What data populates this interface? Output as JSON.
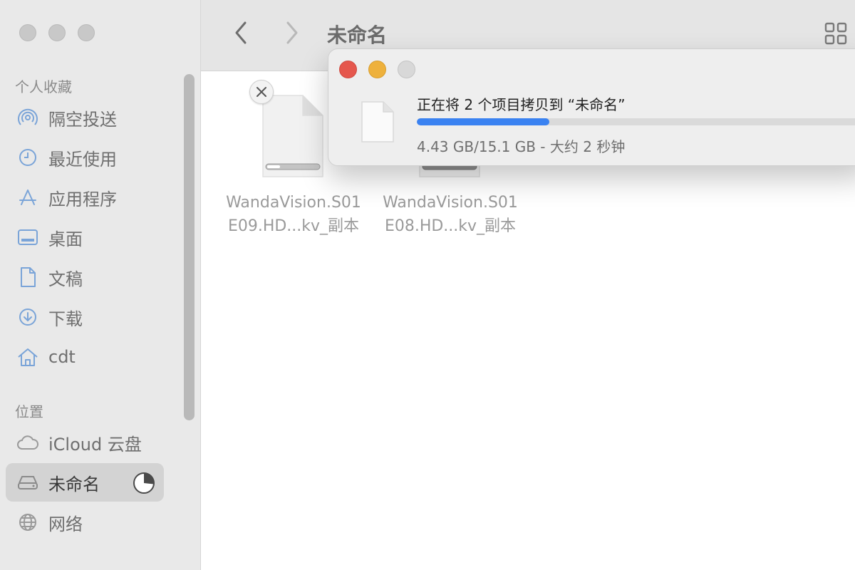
{
  "sidebar": {
    "favorites_title": "个人收藏",
    "locations_title": "位置",
    "favorites": [
      {
        "label": "隔空投送",
        "icon": "airdrop-icon"
      },
      {
        "label": "最近使用",
        "icon": "clock-icon"
      },
      {
        "label": "应用程序",
        "icon": "applications-icon"
      },
      {
        "label": "桌面",
        "icon": "desktop-icon"
      },
      {
        "label": "文稿",
        "icon": "document-icon"
      },
      {
        "label": "下载",
        "icon": "download-icon"
      },
      {
        "label": "cdt",
        "icon": "home-icon"
      }
    ],
    "locations": [
      {
        "label": "iCloud 云盘",
        "icon": "cloud-icon"
      },
      {
        "label": "未命名",
        "icon": "drive-icon",
        "selected": true
      },
      {
        "label": "网络",
        "icon": "globe-icon"
      }
    ]
  },
  "toolbar": {
    "title": "未命名"
  },
  "files": [
    {
      "name_line1": "WandaVision.S01",
      "name_line2": "E09.HD...kv_副本"
    },
    {
      "name_line1": "WandaVision.S01",
      "name_line2": "E08.HD...kv_副本"
    }
  ],
  "copy_dialog": {
    "title": "正在将 2 个项目拷贝到 “未命名”",
    "status": "4.43 GB/15.1 GB - 大约 2 秒钟",
    "progress": 0.29
  },
  "colors": {
    "accent": "#3a82f1",
    "close": "#e5574d",
    "minimize": "#eeb13c",
    "zoom_inactive": "#d8d8d8"
  }
}
